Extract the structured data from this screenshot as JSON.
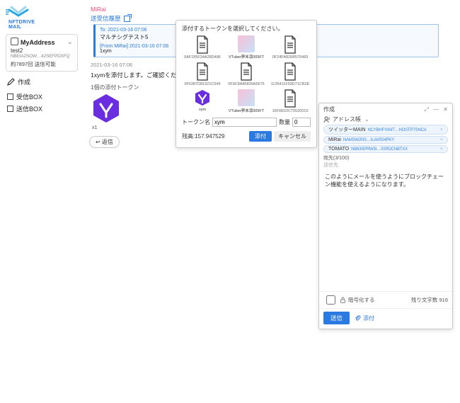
{
  "brand": {
    "name": "NFTDRIVE",
    "sub": "MAIL"
  },
  "sidebar": {
    "address_label": "MyAddress",
    "account_name": "test2",
    "account_id": "NBEIA2SOW…42SEFPDXFQ",
    "account_stat": "約7897回 送信可能",
    "compose": "作成",
    "boxes": [
      {
        "label": "受信BOX"
      },
      {
        "label": "送信BOX"
      }
    ]
  },
  "thread": {
    "to_name": "MiRai",
    "history_label": "送受信履歴",
    "card": {
      "ts": "To: 2021-03-16 07:06",
      "subject": "マルチシグテスト5",
      "from_line": "[From MiRai] 2021-03-16 07:06",
      "from_body": "1xym"
    },
    "body_ts": "2021-03-16 07:06",
    "body_text": "1xymを添付します。ご確認ください。",
    "attach_head": "1個の添付トークン",
    "attach_name": "x1",
    "reply": "↩ 返信"
  },
  "modal": {
    "title": "添付するトークンを選択してください。",
    "tokens": [
      {
        "kind": "doc",
        "id": "0AF185F34A28D486",
        "sub": ""
      },
      {
        "kind": "img",
        "id": "",
        "sub": "VTuber夢末凛005FT"
      },
      {
        "kind": "doc",
        "id": "0F24FA826B575483",
        "sub": ""
      },
      {
        "kind": "doc",
        "id": "0F6387D81921C549",
        "sub": ""
      },
      {
        "kind": "doc",
        "id": "0F9C8A85830A5676",
        "sub": ""
      },
      {
        "kind": "doc",
        "id": "1125411F93D71CB2E",
        "sub": ""
      },
      {
        "kind": "y",
        "id": "",
        "sub": "xym"
      },
      {
        "kind": "img",
        "id": "",
        "sub": "VTuber夢末凛005FT"
      },
      {
        "kind": "doc",
        "id": "16F081DC75520010",
        "sub": ""
      }
    ],
    "token_name_label": "トークン名",
    "token_name_value": "xym",
    "qty_label": "数量",
    "qty_value": "0",
    "balance_label": "残高:157.947529",
    "attach_btn": "添付",
    "cancel_btn": "キャンセル"
  },
  "compose": {
    "title": "作成",
    "address_label": "アドレス帳",
    "recipients": [
      {
        "name": "ツイッターMAIN",
        "id": "NCYBHFYANT…HOSTPTSNCA"
      },
      {
        "name": "MiRai",
        "id": "NAMSW2NS…ILAV5S4PKY"
      },
      {
        "name": "TOMATO",
        "id": "NB63SPRW3I…XSR2CNBTXX"
      }
    ],
    "count": "宛先(3/100)",
    "to_hint": "送信先",
    "body": "このようにメールを使うようにブロックチェーン機能を使えるようになります。",
    "encrypt": "暗号化する",
    "chars": "残り文字数 916",
    "send": "送信",
    "attach": "添付"
  }
}
